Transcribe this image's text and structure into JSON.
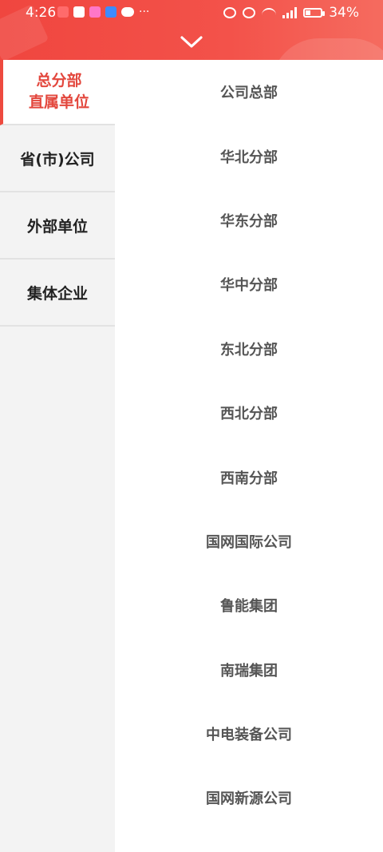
{
  "status_bar": {
    "time": "4:26",
    "battery_text": "34%",
    "battery_level_percent": 34,
    "icons": [
      "notification-icon",
      "battery-alert-icon",
      "app-icon",
      "app-icon",
      "wechat-icon",
      "more-notifications-icon",
      "alarm-icon",
      "mute-icon",
      "wifi-icon",
      "signal-icon",
      "battery-icon"
    ]
  },
  "header": {
    "collapse_icon": "chevron-down-icon",
    "accent_color": "#f0463f"
  },
  "sidebar": {
    "items": [
      {
        "label": "总分部\n直属单位"
      },
      {
        "label": "省(市)公司"
      },
      {
        "label": "外部单位"
      },
      {
        "label": "集体企业"
      }
    ]
  },
  "units": [
    "公司总部",
    "华北分部",
    "华东分部",
    "华中分部",
    "东北分部",
    "西北分部",
    "西南分部",
    "国网国际公司",
    "鲁能集团",
    "南瑞集团",
    "中电装备公司",
    "国网新源公司"
  ]
}
